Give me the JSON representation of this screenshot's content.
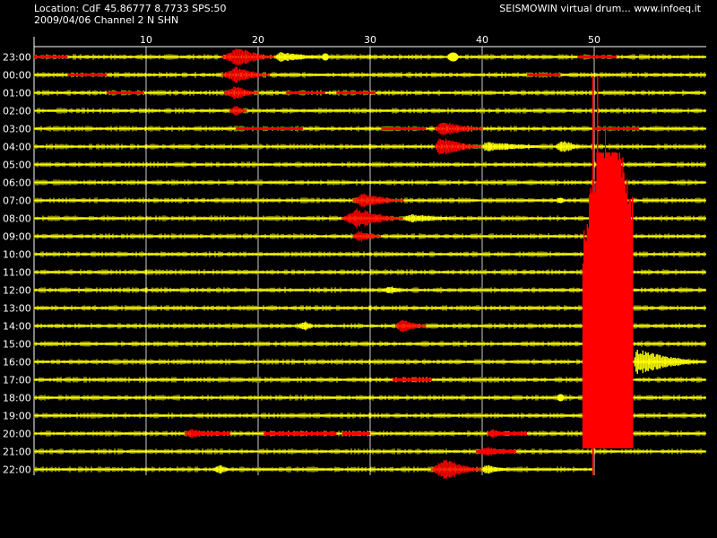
{
  "header": {
    "location": "Location: CdF 45.86777 8.7733 SPS:50",
    "date_channel": "2009/04/06  Channel 2 N SHN",
    "brand": "SEISMOWIN virtual drum... www.infoeq.it"
  },
  "drum": {
    "minute_ticks": [
      "10",
      "20",
      "30",
      "40",
      "50"
    ],
    "hours": [
      "23:00",
      "00:00",
      "01:00",
      "02:00",
      "03:00",
      "04:00",
      "05:00",
      "06:00",
      "07:00",
      "08:00",
      "09:00",
      "10:00",
      "11:00",
      "12:00",
      "13:00",
      "14:00",
      "15:00",
      "16:00",
      "17:00",
      "18:00",
      "19:00",
      "20:00",
      "21:00",
      "22:00"
    ],
    "trace_color": "#ffff00",
    "event_color": "#ff0000",
    "background_color": "#000000",
    "grid_color": "#ffffff"
  }
}
